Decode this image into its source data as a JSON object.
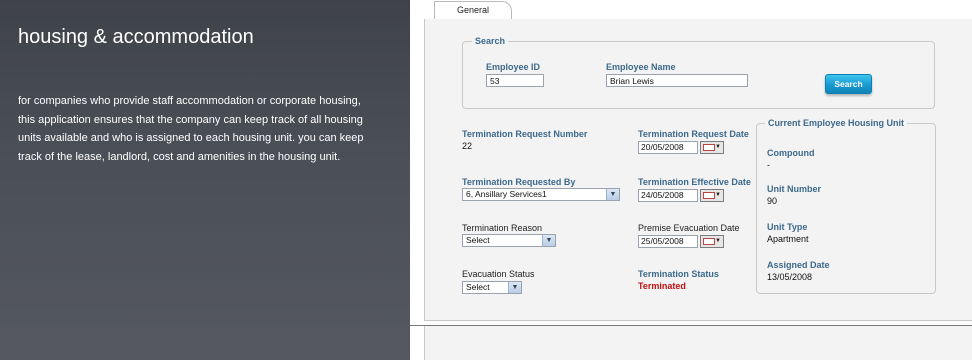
{
  "left": {
    "title": "housing & accommodation",
    "description": "for companies who provide staff accommodation or corporate housing, this application ensures that the company can keep track of all housing units available and who is assigned to each housing unit.  you can keep track of the lease, landlord, cost and amenities in the housing unit."
  },
  "tab": {
    "label": "General"
  },
  "search": {
    "legend": "Search",
    "employee_id_label": "Employee ID",
    "employee_id_value": "53",
    "employee_name_label": "Employee Name",
    "employee_name_value": "Brian Lewis",
    "button_label": "Search"
  },
  "form": {
    "request_number_label": "Termination Request Number",
    "request_number_value": "22",
    "request_date_label": "Termination Request Date",
    "request_date_value": "20/05/2008",
    "requested_by_label": "Termination Requested By",
    "requested_by_value": "6, Ansillary Services1",
    "effective_date_label": "Termination Effective Date",
    "effective_date_value": "24/05/2008",
    "reason_label": "Termination Reason",
    "reason_value": "Select",
    "evacuation_date_label": "Premise Evacuation Date",
    "evacuation_date_value": "25/05/2008",
    "evacuation_status_label": "Evacuation Status",
    "evacuation_status_value": "Select",
    "termination_status_label": "Termination Status",
    "termination_status_value": "Terminated"
  },
  "housing_unit": {
    "legend": "Current Employee Housing Unit",
    "compound_label": "Compound",
    "compound_value": "-",
    "unit_number_label": "Unit Number",
    "unit_number_value": "90",
    "unit_type_label": "Unit Type",
    "unit_type_value": "Apartment",
    "assigned_date_label": "Assigned Date",
    "assigned_date_value": "13/05/2008"
  },
  "colors": {
    "label_blue": "#3d6a8c",
    "status_red": "#c01010",
    "button_blue": "#1a9bd0",
    "left_panel": "#4a4e55"
  }
}
